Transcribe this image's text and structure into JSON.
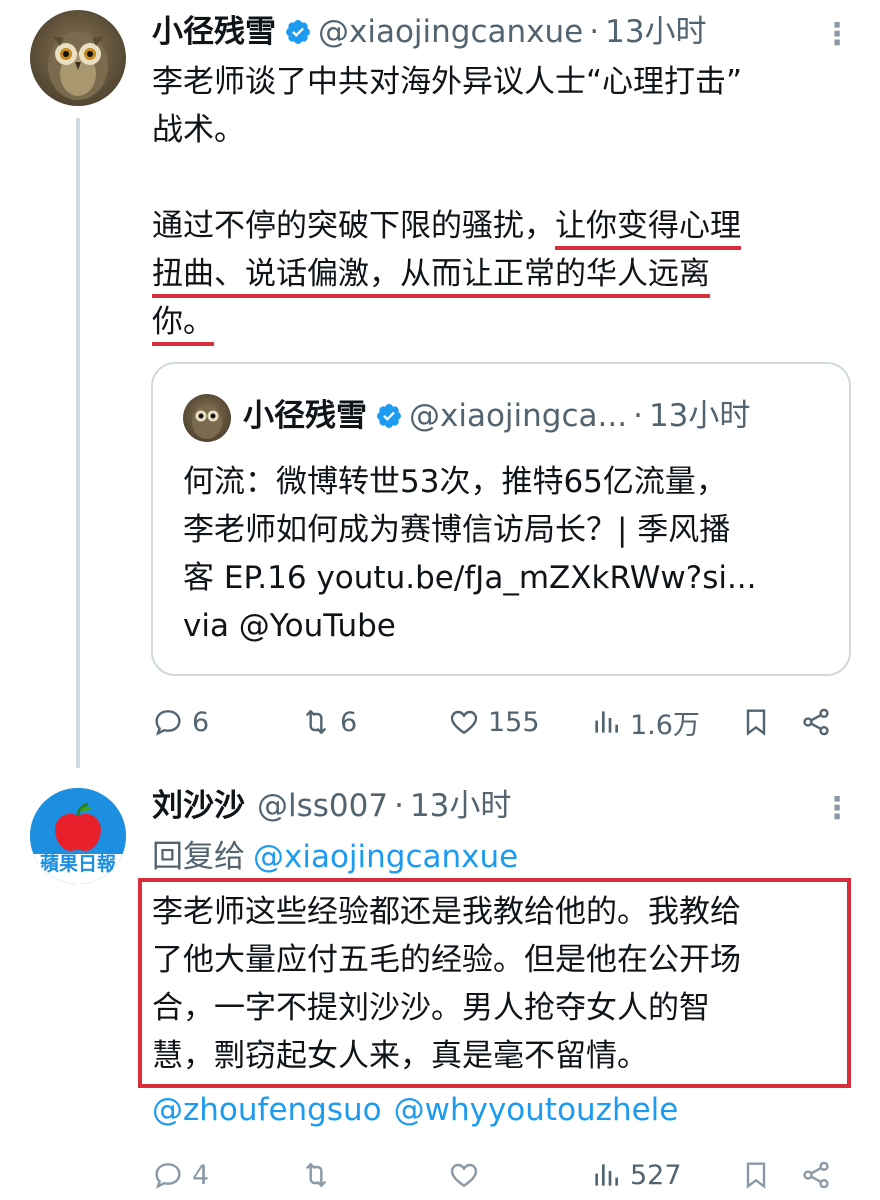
{
  "tweet1": {
    "name": "小径残雪",
    "handle": "@xiaojingcanxue",
    "dot": "·",
    "time": "13小时",
    "more": "⋮",
    "line1": "李老师谈了中共对海外异议人士“心理打击”",
    "line2": "战术。",
    "line3_plain": "通过不停的突破下限的骚扰，",
    "line3_hl": "让你变得心理",
    "line4_hl": "扭曲、说话偏激，从而让正常的华人远离",
    "line5_hl": "你。",
    "quote": {
      "name": "小径残雪",
      "handle": "@xiaojingca...",
      "dot": "·",
      "time": "13小时",
      "line1": "何流：微博转世53次，推特65亿流量，",
      "line2": "李老师如何成为赛博信访局长？| 季风播",
      "line3": "客 EP.16 youtu.be/fJa_mZXkRWw?si...",
      "line4": "via @YouTube"
    },
    "actions": {
      "replies": "6",
      "retweets": "6",
      "likes": "155",
      "views": "1.6万"
    }
  },
  "tweet2": {
    "name": "刘沙沙",
    "handle": "@lss007",
    "dot": "·",
    "time": "13小时",
    "more": "⋮",
    "reply_label": "回复给",
    "reply_handle": "@xiaojingcanxue",
    "line1": "李老师这些经验都还是我教给他的。我教给",
    "line2": "了他大量应付五毛的经验。但是他在公开场",
    "line3": "合，一字不提刘沙沙。男人抢夺女人的智",
    "line4": "慧，剽窃起女人来，真是毫不留情。",
    "mention1": "@zhoufengsuo",
    "mention2": "@whyyoutouzhele",
    "avatar_text": "蘋果日報",
    "actions": {
      "replies": "4",
      "retweets": "",
      "likes": "",
      "views": "527"
    }
  },
  "icons": {
    "reply": "reply-icon",
    "retweet": "retweet-icon",
    "like": "heart-icon",
    "views": "views-icon",
    "bookmark": "bookmark-icon",
    "share": "share-icon",
    "verified": "verified-badge-icon"
  },
  "colors": {
    "link": "#1d9bf0",
    "muted": "#536471",
    "highlight_red": "#d92d3c",
    "verified": "#1d9bf0"
  }
}
